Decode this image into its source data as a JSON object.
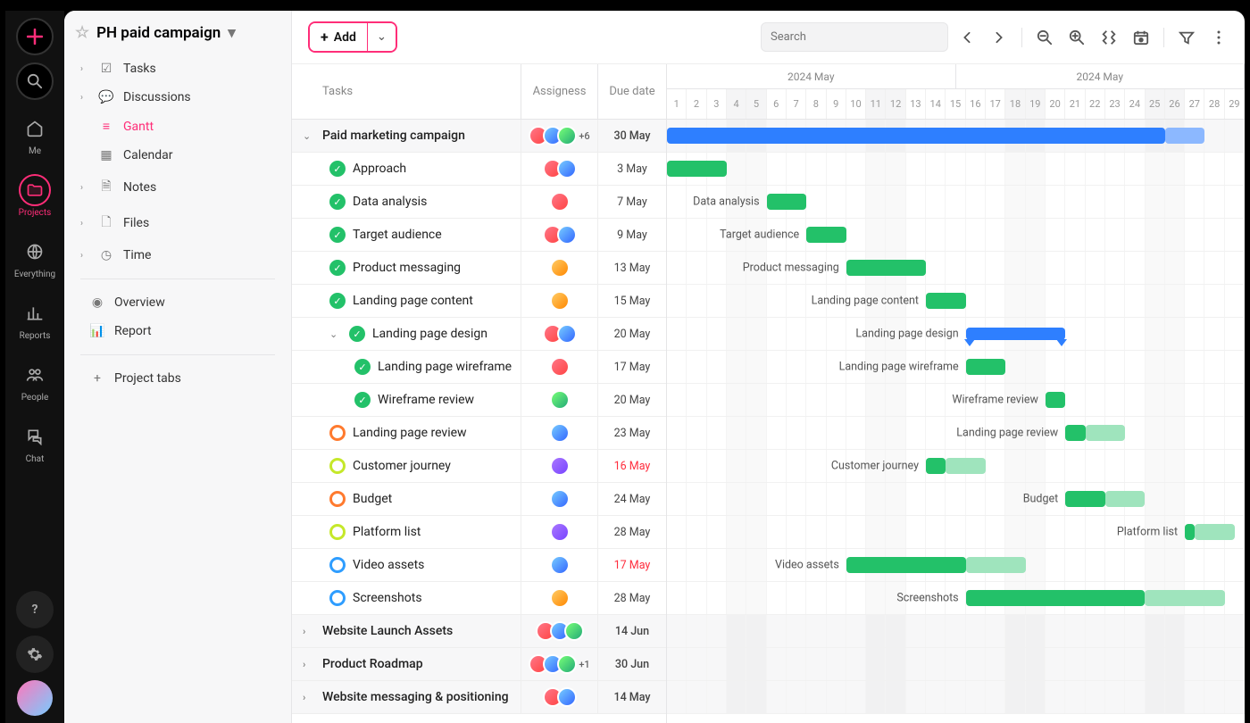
{
  "rail": {
    "items": [
      "Me",
      "Projects",
      "Everything",
      "Reports",
      "People",
      "Chat"
    ]
  },
  "project": {
    "title": "PH paid campaign"
  },
  "nav": {
    "items": [
      "Tasks",
      "Discussions",
      "Gantt",
      "Calendar",
      "Notes",
      "Files",
      "Time"
    ],
    "section2": [
      "Overview",
      "Report"
    ],
    "addTabs": "Project tabs"
  },
  "toolbar": {
    "add": "Add",
    "searchPlaceholder": "Search"
  },
  "columns": {
    "tasks": "Tasks",
    "assignees": "Assigness",
    "dueDate": "Due date"
  },
  "timeline": {
    "months": [
      "2024 May",
      "2024 May"
    ],
    "days": [
      1,
      2,
      3,
      4,
      5,
      6,
      7,
      8,
      9,
      10,
      11,
      12,
      13,
      14,
      15,
      16,
      17,
      18,
      19,
      20,
      21,
      22,
      23,
      24,
      25,
      26,
      27,
      28,
      29
    ],
    "weekends": [
      4,
      5,
      11,
      12,
      18,
      19,
      25,
      26
    ]
  },
  "rows": [
    {
      "type": "group",
      "name": "Paid marketing campaign",
      "due": "30 May",
      "avatars": 3,
      "more": "+6",
      "bar": {
        "type": "blue",
        "start": 1,
        "span": 25,
        "lightExtra": 2
      }
    },
    {
      "type": "task",
      "indent": 1,
      "status": "done",
      "name": "Approach",
      "due": "3 May",
      "avatars": 2,
      "bar": {
        "type": "green",
        "start": 1,
        "span": 3
      }
    },
    {
      "type": "task",
      "indent": 1,
      "status": "done",
      "name": "Data analysis",
      "due": "7 May",
      "avatars": 1,
      "bar": {
        "type": "green",
        "start": 6,
        "span": 2,
        "label": "Data analysis"
      }
    },
    {
      "type": "task",
      "indent": 1,
      "status": "done",
      "name": "Target audience",
      "due": "9 May",
      "avatars": 2,
      "bar": {
        "type": "green",
        "start": 8,
        "span": 2,
        "label": "Target audience"
      }
    },
    {
      "type": "task",
      "indent": 1,
      "status": "done",
      "name": "Product messaging",
      "due": "13 May",
      "avatars": 1,
      "avColor": 3,
      "bar": {
        "type": "green",
        "start": 10,
        "span": 4,
        "label": "Product messaging"
      }
    },
    {
      "type": "task",
      "indent": 1,
      "status": "done",
      "name": "Landing page content",
      "due": "15 May",
      "avatars": 1,
      "avColor": 3,
      "bar": {
        "type": "green",
        "start": 14,
        "span": 2,
        "label": "Landing page content"
      }
    },
    {
      "type": "subgroup",
      "indent": 1,
      "status": "done",
      "name": "Landing page design",
      "due": "20 May",
      "avatars": 2,
      "bar": {
        "type": "summary",
        "start": 16,
        "span": 5,
        "label": "Landing page design"
      }
    },
    {
      "type": "task",
      "indent": 2,
      "status": "done",
      "name": "Landing page wireframe",
      "due": "17 May",
      "avatars": 1,
      "avColor": 0,
      "bar": {
        "type": "green",
        "start": 16,
        "span": 2,
        "label": "Landing page wireframe"
      }
    },
    {
      "type": "task",
      "indent": 2,
      "status": "done",
      "name": "Wireframe review",
      "due": "20 May",
      "avatars": 1,
      "avColor": 2,
      "bar": {
        "type": "green",
        "start": 20,
        "span": 1,
        "label": "Wireframe review"
      }
    },
    {
      "type": "task",
      "indent": 1,
      "status": "orange",
      "name": "Landing page review",
      "due": "23 May",
      "avatars": 1,
      "avColor": 1,
      "bar": {
        "type": "split",
        "start": 21,
        "span": 1,
        "lightExtra": 2,
        "label": "Landing page review"
      }
    },
    {
      "type": "task",
      "indent": 1,
      "status": "lime",
      "name": "Customer journey",
      "due": "16 May",
      "overdue": true,
      "avatars": 1,
      "avColor": 4,
      "bar": {
        "type": "split",
        "start": 14,
        "span": 1,
        "lightExtra": 2,
        "label": "Customer journey"
      }
    },
    {
      "type": "task",
      "indent": 1,
      "status": "orange",
      "name": "Budget",
      "due": "24 May",
      "avatars": 1,
      "avColor": 1,
      "bar": {
        "type": "split",
        "start": 21,
        "span": 2,
        "lightExtra": 2,
        "label": "Budget"
      }
    },
    {
      "type": "task",
      "indent": 1,
      "status": "lime",
      "name": "Platform list",
      "due": "28 May",
      "avatars": 1,
      "avColor": 4,
      "bar": {
        "type": "split",
        "start": 27,
        "span": 0.5,
        "lightExtra": 2,
        "label": "Platform list"
      }
    },
    {
      "type": "task",
      "indent": 1,
      "status": "blue",
      "name": "Video assets",
      "due": "17 May",
      "overdue": true,
      "avatars": 1,
      "avColor": 1,
      "bar": {
        "type": "split",
        "start": 10,
        "span": 6,
        "lightExtra": 3,
        "label": "Video assets"
      }
    },
    {
      "type": "task",
      "indent": 1,
      "status": "blue",
      "name": "Screenshots",
      "due": "28 May",
      "avatars": 1,
      "avColor": 3,
      "bar": {
        "type": "split",
        "start": 16,
        "span": 9,
        "lightExtra": 4,
        "label": "Screenshots"
      }
    },
    {
      "type": "group",
      "name": "Website Launch Assets",
      "due": "14 Jun",
      "avatars": 3,
      "collapsed": true
    },
    {
      "type": "group",
      "name": "Product Roadmap",
      "due": "30 Jun",
      "avatars": 3,
      "more": "+1",
      "collapsed": true
    },
    {
      "type": "group",
      "name": "Website messaging & positioning",
      "due": "14 May",
      "avatars": 2,
      "collapsed": true
    }
  ]
}
